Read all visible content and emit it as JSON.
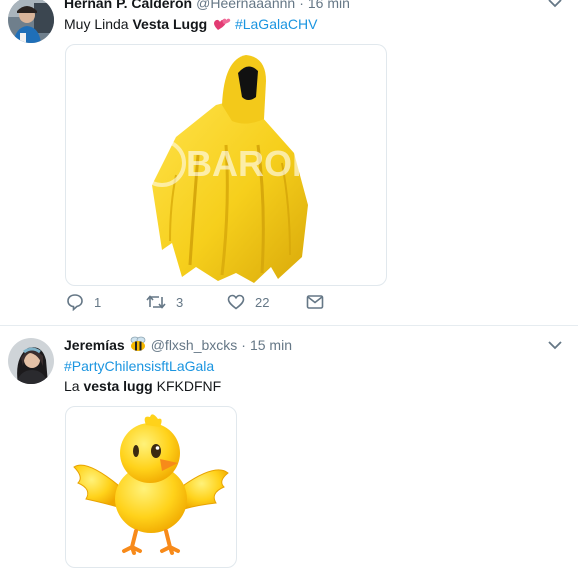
{
  "tweets": [
    {
      "fullname": "Hernán P. Calderón",
      "handle": "@Heernaaannn",
      "time": "16 min",
      "text_before": "Muy Linda ",
      "text_bold": "Vesta Lugg",
      "hashtag": "#LaGalaCHV",
      "image_watermark": "BARON",
      "actions": {
        "replies": "1",
        "retweets": "3",
        "likes": "22"
      }
    },
    {
      "fullname": "Jeremías",
      "handle": "@flxsh_bxcks",
      "time": "15 min",
      "hashtag": "#PartyChilensisftLaGala",
      "text_before": "La ",
      "text_bold": "vesta lugg",
      "text_after": " KFKDFNF"
    }
  ],
  "separator": "·",
  "colors": {
    "link": "#1b95e0",
    "muted": "#657786",
    "border": "#e6ecf0",
    "yellow": "#f7d21e"
  },
  "icons": [
    "reply-icon",
    "retweet-icon",
    "like-icon",
    "direct-message-icon",
    "chevron-down-icon",
    "two-hearts-emoji",
    "bee-emoji"
  ]
}
